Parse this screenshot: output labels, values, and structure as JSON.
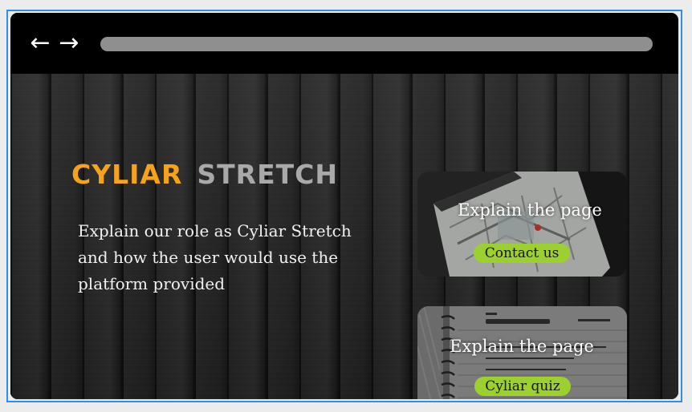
{
  "nav": {
    "back_icon": "arrow-left-icon",
    "back_glyph": "←",
    "forward_icon": "arrow-right-icon",
    "forward_glyph": "→"
  },
  "hero": {
    "brand_part1": "CYLIAR",
    "brand_part2": "STRETCH",
    "description": "Explain our role as Cyliar Stretch and how the user would use the platform provided"
  },
  "cards": [
    {
      "title": "Explain the page",
      "button": "Contact us"
    },
    {
      "title": "Explain the page",
      "button": "Cyliar quiz"
    }
  ],
  "colors": {
    "accent_orange": "#f7a21b",
    "accent_green": "#9bd02f",
    "frame_blue": "#2f8fe8"
  }
}
